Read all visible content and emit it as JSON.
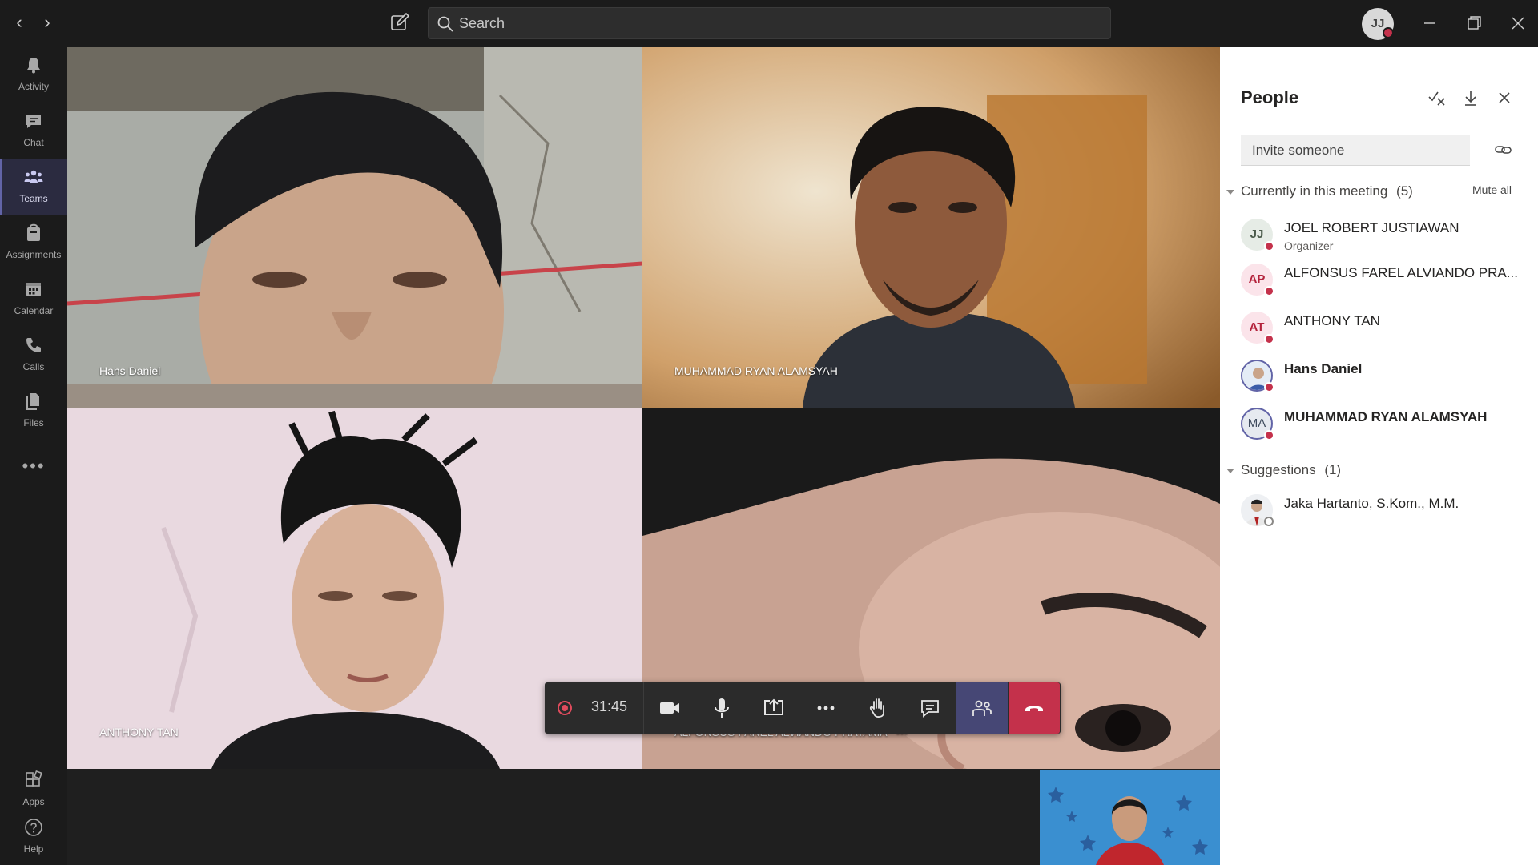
{
  "search": {
    "placeholder": "Search"
  },
  "user": {
    "initials": "JJ"
  },
  "rail": [
    {
      "label": "Activity",
      "icon": "bell-icon"
    },
    {
      "label": "Chat",
      "icon": "chat-icon"
    },
    {
      "label": "Teams",
      "icon": "teams-icon",
      "active": true
    },
    {
      "label": "Assignments",
      "icon": "assignments-icon"
    },
    {
      "label": "Calendar",
      "icon": "calendar-icon"
    },
    {
      "label": "Calls",
      "icon": "phone-icon"
    },
    {
      "label": "Files",
      "icon": "files-icon"
    },
    {
      "label": "Apps",
      "icon": "apps-icon"
    },
    {
      "label": "Help",
      "icon": "help-icon"
    }
  ],
  "rail_more": "•••",
  "tiles": [
    {
      "name": "Hans Daniel"
    },
    {
      "name": "MUHAMMAD RYAN ALAMSYAH"
    },
    {
      "name": "ANTHONY TAN"
    },
    {
      "name": "ALFONSUS FAREL ALVIANDO PRATAMA"
    }
  ],
  "tile_more": "•••",
  "call": {
    "timer": "31:45"
  },
  "people": {
    "title": "People",
    "invite_placeholder": "Invite someone",
    "current_header": "Currently in this meeting",
    "current_count": "(5)",
    "mute_all": "Mute all",
    "participants": [
      {
        "initials": "JJ",
        "name": "JOEL ROBERT JUSTIAWAN",
        "role": "Organizer",
        "avatar_bg": "#e6ece6",
        "avatar_fg": "#4a5a4a"
      },
      {
        "initials": "AP",
        "name": "ALFONSUS FAREL ALVIANDO PRA...",
        "avatar_bg": "#fbe4ea",
        "avatar_fg": "#b4233c"
      },
      {
        "initials": "AT",
        "name": "ANTHONY TAN",
        "avatar_bg": "#fbe4ea",
        "avatar_fg": "#b4233c"
      },
      {
        "initials": "",
        "name": "Hans Daniel",
        "photo": true
      },
      {
        "initials": "MA",
        "name": "MUHAMMAD RYAN ALAMSYAH",
        "avatar_bg": "#e6eaf0",
        "avatar_fg": "#3f4c5e"
      }
    ],
    "suggestions_header": "Suggestions",
    "suggestions_count": "(1)",
    "suggestions": [
      {
        "name": "Jaka Hartanto, S.Kom., M.M."
      }
    ]
  },
  "colors": {
    "accent": "#6264a7",
    "hangup": "#c4314b",
    "status": "#c4314b"
  }
}
